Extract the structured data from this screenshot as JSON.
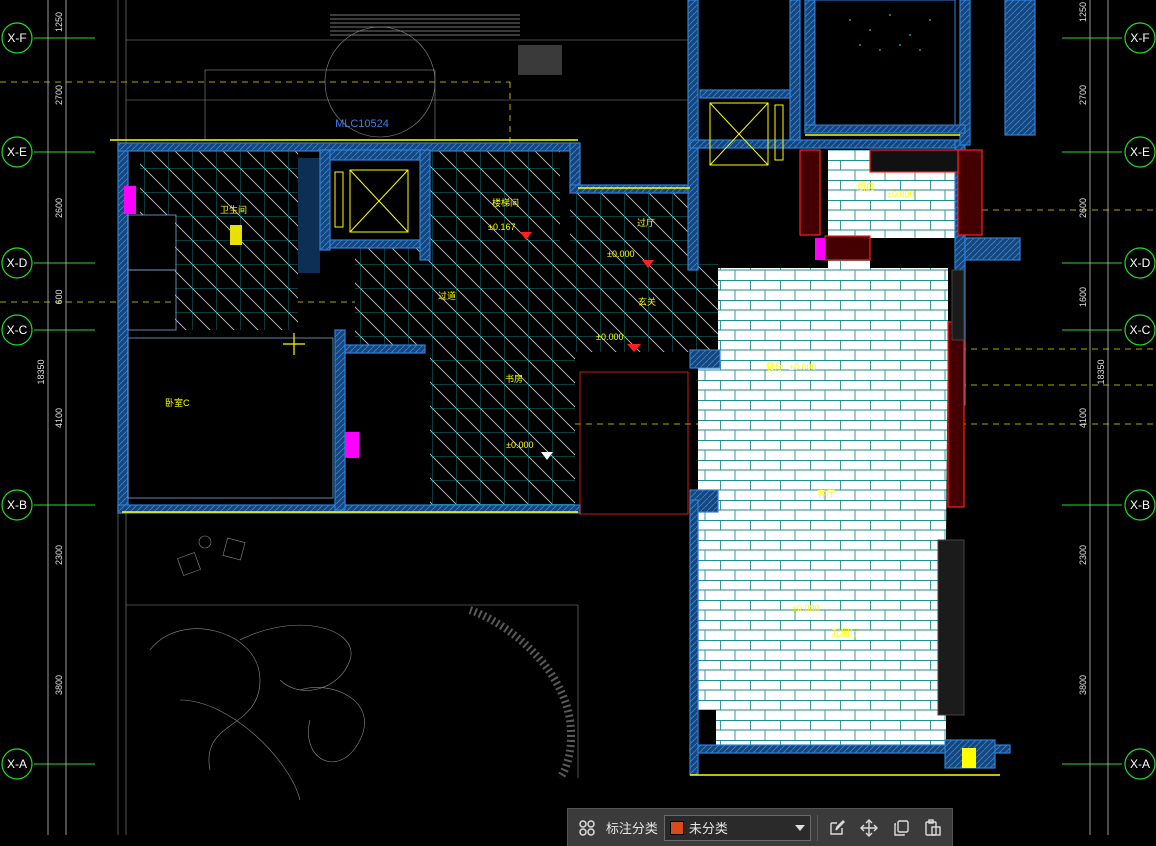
{
  "drawing": {
    "grid_labels": [
      "X-F",
      "X-E",
      "X-D",
      "X-C",
      "X-B",
      "X-A"
    ],
    "dimensions_left": [
      "1250",
      "2700",
      "2600",
      "600",
      "4100",
      "2300",
      "3800",
      "18350"
    ],
    "dimensions_right": [
      "1250",
      "2700",
      "2600",
      "1600",
      "4100",
      "2300",
      "3800",
      "18350"
    ],
    "window_tag": "MLC10524",
    "room_labels": [
      "卫生间",
      "楼梯间",
      "过厅",
      "过道",
      "玄关",
      "卧室C",
      "书房",
      "厨房",
      "餐厅",
      "客厅",
      "起居厅"
    ],
    "elevations": [
      "±0.167",
      "±0.000",
      "±0.000",
      "±0.000",
      "±0.000",
      "±0.000",
      "±0.000"
    ],
    "colors": {
      "wall": "#2060c0",
      "hatch": "#19b4b4",
      "tile": "#ffffff",
      "axis": "#22dd22",
      "yellow": "#ffff00",
      "red": "#ff2020",
      "magenta": "#ff00ff",
      "accent": "#d94a1e"
    }
  },
  "toolbar": {
    "grid_icon": "grid-icon",
    "label": "标注分类",
    "category": {
      "selected": "未分类",
      "swatch_color": "#d94a1e"
    },
    "icons": [
      "edit-icon",
      "move-icon",
      "copy-icon",
      "paste-icon"
    ]
  }
}
